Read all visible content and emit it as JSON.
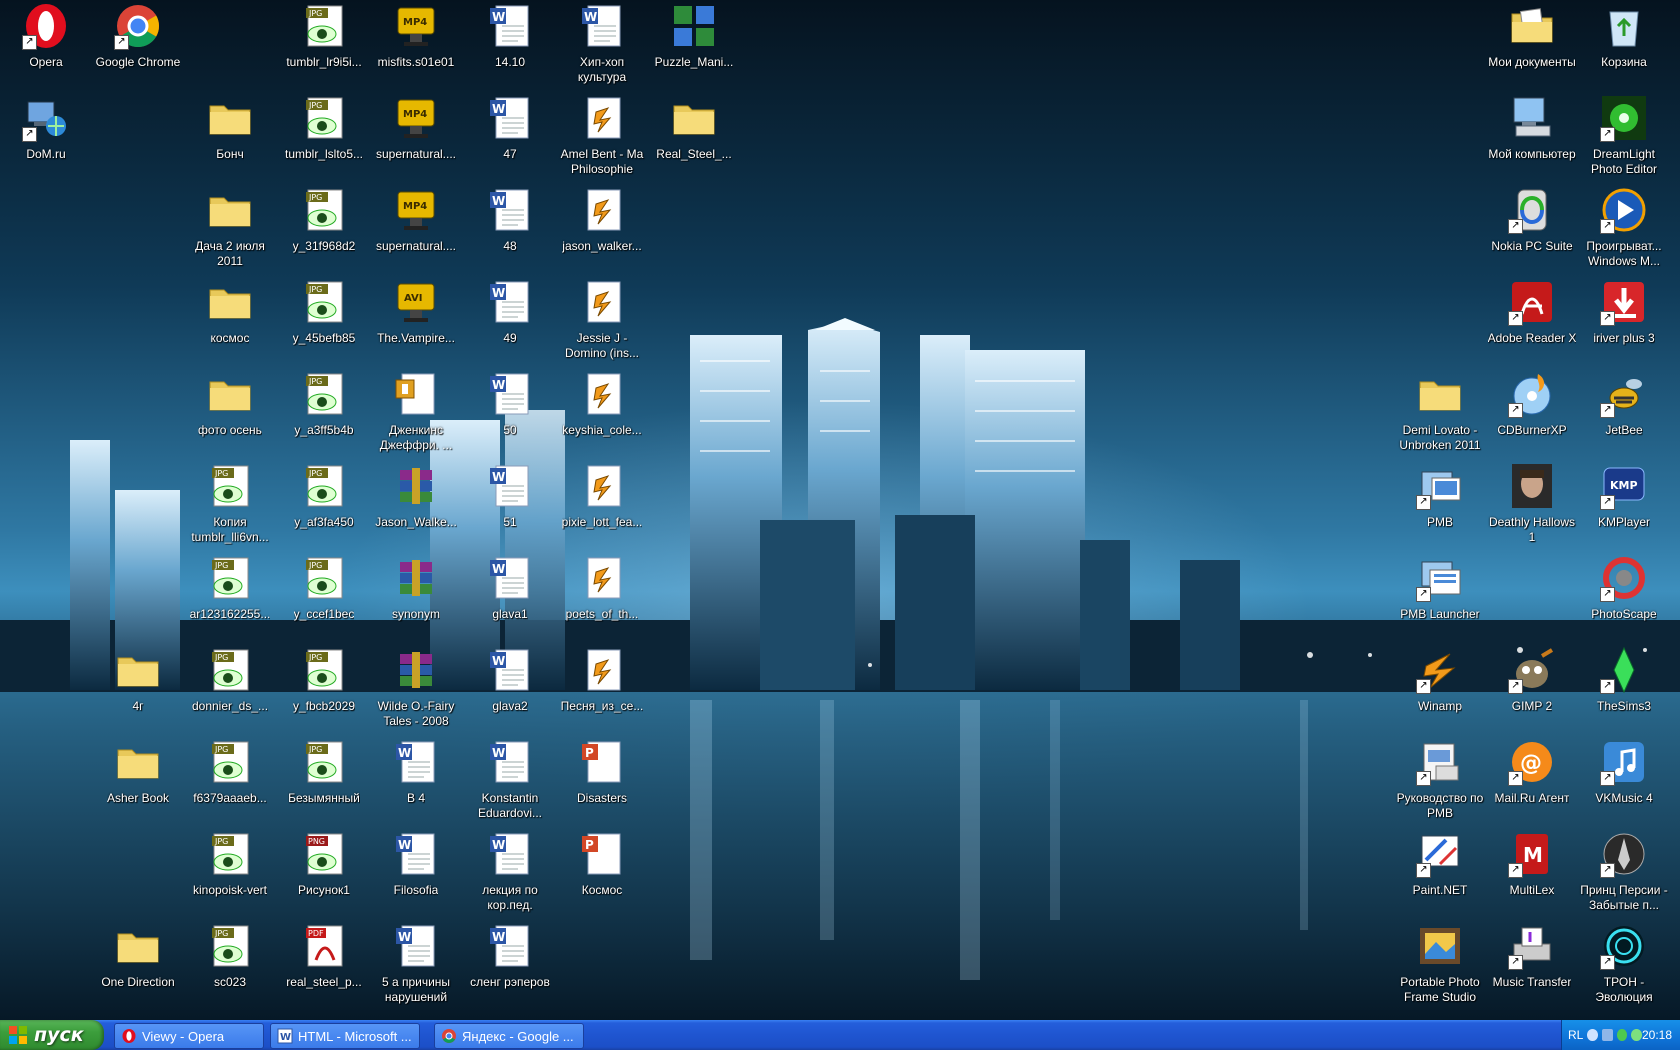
{
  "desktop_icons": [
    {
      "label": "Opera",
      "icon": "opera-icon",
      "col": 0,
      "row": 0,
      "shortcut": true
    },
    {
      "label": "Google Chrome",
      "icon": "chrome-icon",
      "col": 1,
      "row": 0,
      "shortcut": true
    },
    {
      "label": "DoM.ru",
      "icon": "network-icon",
      "col": 0,
      "row": 1,
      "shortcut": true
    },
    {
      "label": "Бонч",
      "icon": "folder-icon",
      "col": 2,
      "row": 1
    },
    {
      "label": "Дача 2 июля 2011",
      "icon": "folder-icon",
      "col": 2,
      "row": 2
    },
    {
      "label": "космос",
      "icon": "folder-icon",
      "col": 2,
      "row": 3
    },
    {
      "label": "фото осень",
      "icon": "folder-icon",
      "col": 2,
      "row": 4
    },
    {
      "label": "Копия tumblr_lli6vn...",
      "icon": "jpg-icon",
      "col": 2,
      "row": 5
    },
    {
      "label": "ar123162255...",
      "icon": "jpg-icon",
      "col": 2,
      "row": 6
    },
    {
      "label": "donnier_ds_...",
      "icon": "jpg-icon",
      "col": 2,
      "row": 7
    },
    {
      "label": "f6379aaaeb...",
      "icon": "jpg-icon",
      "col": 2,
      "row": 8
    },
    {
      "label": "kinopoisk-vert",
      "icon": "jpg-icon",
      "col": 2,
      "row": 9
    },
    {
      "label": "sc023",
      "icon": "jpg-icon",
      "col": 2,
      "row": 10
    },
    {
      "label": "4г",
      "icon": "folder-icon",
      "col": 1,
      "row": 7
    },
    {
      "label": "Asher Book",
      "icon": "folder-icon",
      "col": 1,
      "row": 8
    },
    {
      "label": "One Direction",
      "icon": "folder-icon",
      "col": 1,
      "row": 10
    },
    {
      "label": "tumblr_lr9i5i...",
      "icon": "jpg-icon",
      "col": 3,
      "row": 0
    },
    {
      "label": "tumblr_lslto5...",
      "icon": "jpg-icon",
      "col": 3,
      "row": 1
    },
    {
      "label": "y_31f968d2",
      "icon": "jpg-icon",
      "col": 3,
      "row": 2
    },
    {
      "label": "y_45befb85",
      "icon": "jpg-icon",
      "col": 3,
      "row": 3
    },
    {
      "label": "y_a3ff5b4b",
      "icon": "jpg-icon",
      "col": 3,
      "row": 4
    },
    {
      "label": "y_af3fa450",
      "icon": "jpg-icon",
      "col": 3,
      "row": 5
    },
    {
      "label": "y_ccef1bec",
      "icon": "jpg-icon",
      "col": 3,
      "row": 6
    },
    {
      "label": "y_fbcb2029",
      "icon": "jpg-icon",
      "col": 3,
      "row": 7
    },
    {
      "label": "Безымянный",
      "icon": "jpg-icon",
      "col": 3,
      "row": 8
    },
    {
      "label": "Рисунок1",
      "icon": "png-icon",
      "col": 3,
      "row": 9
    },
    {
      "label": "real_steel_p...",
      "icon": "pdf-icon",
      "col": 3,
      "row": 10
    },
    {
      "label": "misfits.s01e01",
      "icon": "mp4-icon",
      "col": 4,
      "row": 0
    },
    {
      "label": "supernatural....",
      "icon": "mp4-icon",
      "col": 4,
      "row": 1
    },
    {
      "label": "supernatural....",
      "icon": "mp4-icon",
      "col": 4,
      "row": 2
    },
    {
      "label": "The.Vampire...",
      "icon": "avi-icon",
      "col": 4,
      "row": 3
    },
    {
      "label": "Дженкинс Джеффри. ...",
      "icon": "archive-doc-icon",
      "col": 4,
      "row": 4
    },
    {
      "label": "Jason_Walke...",
      "icon": "winrar-icon",
      "col": 4,
      "row": 5
    },
    {
      "label": "synonym",
      "icon": "winrar-icon",
      "col": 4,
      "row": 6
    },
    {
      "label": "Wilde O.-Fairy Tales - 2008",
      "icon": "winrar-icon",
      "col": 4,
      "row": 7
    },
    {
      "label": "В 4",
      "icon": "word-doc-icon",
      "col": 4,
      "row": 8
    },
    {
      "label": "Filosofia",
      "icon": "word-doc-icon",
      "col": 4,
      "row": 9
    },
    {
      "label": "5 а причины нарушений",
      "icon": "word-doc-icon",
      "col": 4,
      "row": 10
    },
    {
      "label": "14.10",
      "icon": "word-doc-icon",
      "col": 5,
      "row": 0
    },
    {
      "label": "47",
      "icon": "word-doc-icon",
      "col": 5,
      "row": 1
    },
    {
      "label": "48",
      "icon": "word-doc-icon",
      "col": 5,
      "row": 2
    },
    {
      "label": "49",
      "icon": "word-doc-icon",
      "col": 5,
      "row": 3
    },
    {
      "label": "50",
      "icon": "word-doc-icon",
      "col": 5,
      "row": 4
    },
    {
      "label": "51",
      "icon": "word-doc-icon",
      "col": 5,
      "row": 5
    },
    {
      "label": "glava1",
      "icon": "word-doc-icon",
      "col": 5,
      "row": 6
    },
    {
      "label": "glava2",
      "icon": "word-doc-icon",
      "col": 5,
      "row": 7
    },
    {
      "label": "Konstantin Eduardovi...",
      "icon": "word-doc-icon",
      "col": 5,
      "row": 8
    },
    {
      "label": "лекция по кор.пед.",
      "icon": "word-doc-icon",
      "col": 5,
      "row": 9
    },
    {
      "label": "сленг рэперов",
      "icon": "word-doc-icon",
      "col": 5,
      "row": 10
    },
    {
      "label": "Хип-хоп культура",
      "icon": "word-doc-icon",
      "col": 6,
      "row": 0
    },
    {
      "label": "Amel Bent - Ma Philosophie",
      "icon": "winamp-file-icon",
      "col": 6,
      "row": 1
    },
    {
      "label": "jason_walker...",
      "icon": "winamp-file-icon",
      "col": 6,
      "row": 2
    },
    {
      "label": "Jessie J - Domino (ins...",
      "icon": "winamp-file-icon",
      "col": 6,
      "row": 3
    },
    {
      "label": "keyshia_cole...",
      "icon": "winamp-file-icon",
      "col": 6,
      "row": 4
    },
    {
      "label": "pixie_lott_fea...",
      "icon": "winamp-file-icon",
      "col": 6,
      "row": 5
    },
    {
      "label": "poets_of_th...",
      "icon": "winamp-file-icon",
      "col": 6,
      "row": 6
    },
    {
      "label": "Песня_из_се...",
      "icon": "winamp-file-icon",
      "col": 6,
      "row": 7
    },
    {
      "label": "Disasters",
      "icon": "powerpoint-icon",
      "col": 6,
      "row": 8
    },
    {
      "label": "Космос",
      "icon": "powerpoint-icon",
      "col": 6,
      "row": 9
    },
    {
      "label": "Puzzle_Mani...",
      "icon": "puzzle-icon",
      "col": 7,
      "row": 0
    },
    {
      "label": "Real_Steel_...",
      "icon": "folder-icon",
      "col": 7,
      "row": 1
    },
    {
      "label": "Мои документы",
      "icon": "my-documents-icon",
      "col": 16,
      "row": 0
    },
    {
      "label": "Корзина",
      "icon": "recycle-bin-icon",
      "col": 17,
      "row": 0
    },
    {
      "label": "Мой компьютер",
      "icon": "my-computer-icon",
      "col": 16,
      "row": 1
    },
    {
      "label": "DreamLight Photo Editor",
      "icon": "dreamlight-icon",
      "col": 17,
      "row": 1,
      "shortcut": true
    },
    {
      "label": "Nokia PC Suite",
      "icon": "nokia-icon",
      "col": 16,
      "row": 2,
      "shortcut": true
    },
    {
      "label": "Проигрыват... Windows M...",
      "icon": "media-player-icon",
      "col": 17,
      "row": 2,
      "shortcut": true
    },
    {
      "label": "Adobe Reader X",
      "icon": "adobe-reader-icon",
      "col": 16,
      "row": 3,
      "shortcut": true
    },
    {
      "label": "iriver plus 3",
      "icon": "iriver-icon",
      "col": 17,
      "row": 3,
      "shortcut": true
    },
    {
      "label": "Demi Lovato - Unbroken 2011",
      "icon": "folder-icon",
      "col": 15,
      "row": 4
    },
    {
      "label": "CDBurnerXP",
      "icon": "cdburner-icon",
      "col": 16,
      "row": 4,
      "shortcut": true
    },
    {
      "label": "JetBee",
      "icon": "jetbee-icon",
      "col": 17,
      "row": 4,
      "shortcut": true
    },
    {
      "label": "PMB",
      "icon": "pmb-icon",
      "col": 15,
      "row": 5,
      "shortcut": true
    },
    {
      "label": "Deathly Hallows 1",
      "icon": "movie-icon",
      "col": 16,
      "row": 5
    },
    {
      "label": "KMPlayer",
      "icon": "kmplayer-icon",
      "col": 17,
      "row": 5,
      "shortcut": true
    },
    {
      "label": "PMB Launcher",
      "icon": "pmb-launcher-icon",
      "col": 15,
      "row": 6,
      "shortcut": true
    },
    {
      "label": "PhotoScape",
      "icon": "photoscape-icon",
      "col": 17,
      "row": 6,
      "shortcut": true
    },
    {
      "label": "Winamp",
      "icon": "winamp-icon",
      "col": 15,
      "row": 7,
      "shortcut": true
    },
    {
      "label": "GIMP 2",
      "icon": "gimp-icon",
      "col": 16,
      "row": 7,
      "shortcut": true
    },
    {
      "label": "TheSims3",
      "icon": "sims-icon",
      "col": 17,
      "row": 7,
      "shortcut": true
    },
    {
      "label": "Руководство по PMB",
      "icon": "manual-icon",
      "col": 15,
      "row": 8,
      "shortcut": true
    },
    {
      "label": "Mail.Ru Агент",
      "icon": "mailru-agent-icon",
      "col": 16,
      "row": 8,
      "shortcut": true
    },
    {
      "label": "VKMusic 4",
      "icon": "vkmusic-icon",
      "col": 17,
      "row": 8,
      "shortcut": true
    },
    {
      "label": "Paint.NET",
      "icon": "paintnet-icon",
      "col": 15,
      "row": 9,
      "shortcut": true
    },
    {
      "label": "MultiLex",
      "icon": "multilex-icon",
      "col": 16,
      "row": 9,
      "shortcut": true
    },
    {
      "label": "Принц Персии - Забытые п...",
      "icon": "prince-of-persia-icon",
      "col": 17,
      "row": 9,
      "shortcut": true
    },
    {
      "label": "Portable Photo Frame Studio",
      "icon": "photo-frame-icon",
      "col": 15,
      "row": 10
    },
    {
      "label": "Music Transfer",
      "icon": "music-transfer-icon",
      "col": 16,
      "row": 10,
      "shortcut": true
    },
    {
      "label": "ТРОН - Эволюция",
      "icon": "tron-icon",
      "col": 17,
      "row": 10,
      "shortcut": true
    }
  ],
  "taskbar": {
    "start_label": "пуск",
    "tasks": [
      {
        "label": "Viewy - Opera",
        "icon": "opera-icon"
      },
      {
        "label": "HTML - Microsoft ...",
        "icon": "word-icon"
      },
      {
        "label": "Яндекс - Google ...",
        "icon": "chrome-icon"
      }
    ],
    "tray": {
      "language": "RL",
      "clock": "20:18"
    }
  },
  "colors": {
    "taskbar": "#245edb",
    "start": "#3c9e3c",
    "tray": "#0f74d8"
  }
}
